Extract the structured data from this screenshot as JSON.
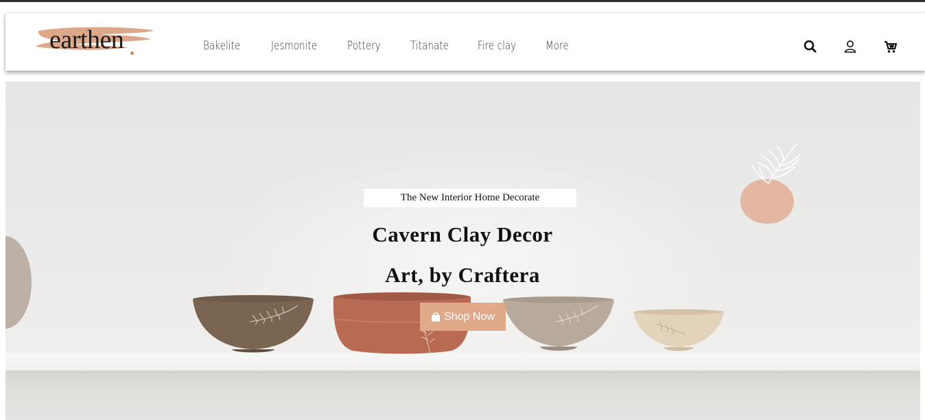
{
  "brand": {
    "logo_text": "earthen",
    "accent_color": "#e0a98a"
  },
  "nav": {
    "items": [
      {
        "label": "Bakelite"
      },
      {
        "label": "Jesmonite"
      },
      {
        "label": "Pottery"
      },
      {
        "label": "Titanate"
      },
      {
        "label": "Fire clay"
      },
      {
        "label": "More"
      }
    ],
    "icons": [
      "search-icon",
      "user-icon",
      "cart-icon"
    ]
  },
  "hero": {
    "subtitle": "The New Interior Home Decorate",
    "headline_line1": "Cavern Clay Decor",
    "headline_line2": "Art, by Craftera",
    "cta_label": "Shop Now",
    "cta_icon": "shopping-bag-icon"
  }
}
